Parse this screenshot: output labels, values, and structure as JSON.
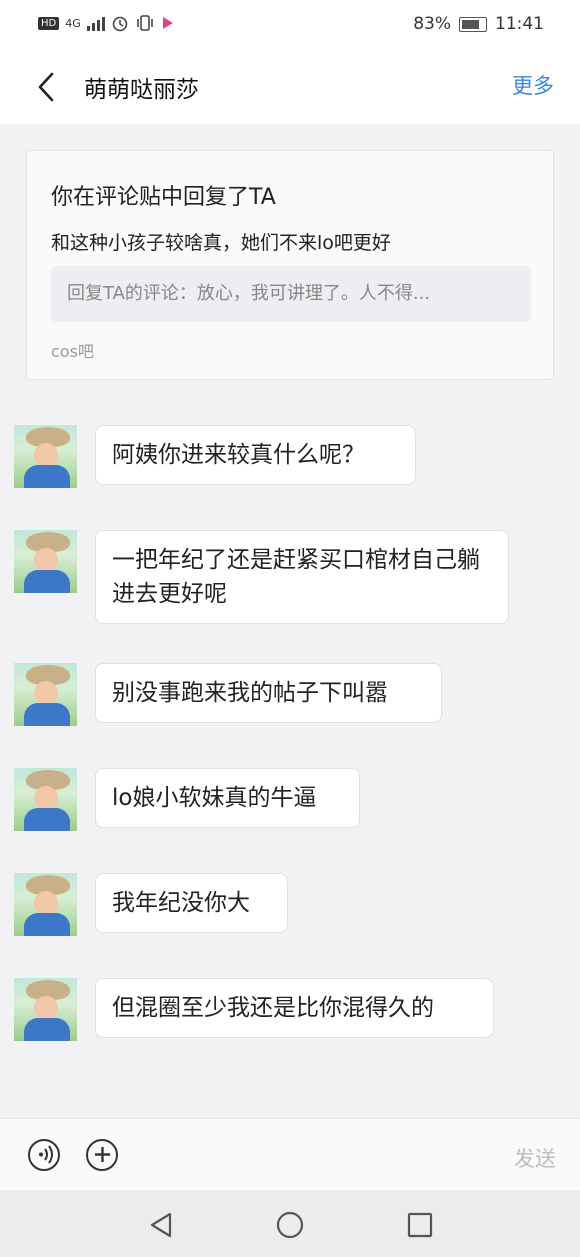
{
  "status_bar": {
    "network": "4G",
    "battery": "83%",
    "time": "11:41"
  },
  "header": {
    "title": "萌萌哒丽莎",
    "more_label": "更多"
  },
  "card": {
    "title": "你在评论贴中回复了TA",
    "body": "和这种小孩子较啥真，她们不来lo吧更好",
    "quote": "回复TA的评论：放心，我可讲理了。人不得...",
    "source": "cos吧"
  },
  "messages": [
    {
      "text": "阿姨你进来较真什么呢？"
    },
    {
      "text": "一把年纪了还是赶紧买口棺材自己躺进去更好呢"
    },
    {
      "text": "别没事跑来我的帖子下叫嚣"
    },
    {
      "text": "lo娘小软妹真的牛逼"
    },
    {
      "text": "我年纪没你大"
    },
    {
      "text": "但混圈至少我还是比你混得久的"
    }
  ],
  "input_bar": {
    "voice_icon": "voice-icon",
    "plus_icon": "plus-icon",
    "send_label": "发送"
  },
  "colors": {
    "accent": "#3a86e0",
    "background": "#f2f2f4"
  }
}
